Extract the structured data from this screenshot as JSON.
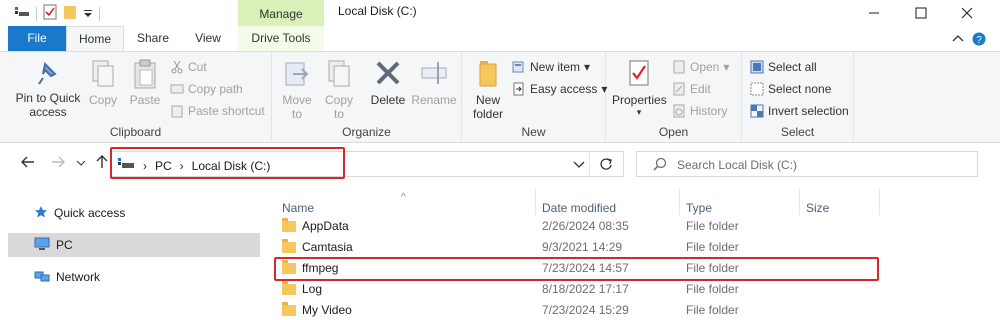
{
  "window": {
    "title": "Local Disk (C:)",
    "contextual_tab_group": "Manage"
  },
  "ribbon_tabs": {
    "file": "File",
    "home": "Home",
    "share": "Share",
    "view": "View",
    "drive_tools": "Drive Tools"
  },
  "clipboard": {
    "label": "Clipboard",
    "pin": [
      "Pin to Quick",
      "access"
    ],
    "copy": "Copy",
    "paste": "Paste",
    "cut": "Cut",
    "copy_path": "Copy path",
    "paste_shortcut": "Paste shortcut"
  },
  "organize": {
    "label": "Organize",
    "move_to": [
      "Move",
      "to"
    ],
    "copy_to": [
      "Copy",
      "to"
    ],
    "delete": "Delete",
    "rename": "Rename"
  },
  "new_group": {
    "label": "New",
    "new_folder": [
      "New",
      "folder"
    ],
    "new_item": "New item",
    "easy_access": "Easy access"
  },
  "open_group": {
    "label": "Open",
    "properties": "Properties",
    "open": "Open",
    "edit": "Edit",
    "history": "History"
  },
  "select_group": {
    "label": "Select",
    "select_all": "Select all",
    "select_none": "Select none",
    "invert_selection": "Invert selection"
  },
  "address": {
    "crumbs": [
      "PC",
      "Local Disk (C:)"
    ],
    "search_placeholder": "Search Local Disk (C:)"
  },
  "nav_pane": {
    "items": [
      "Quick access",
      "PC",
      "Network"
    ],
    "selected": "PC"
  },
  "columns": {
    "name": "Name",
    "date_modified": "Date modified",
    "type": "Type",
    "size": "Size"
  },
  "files": [
    {
      "name": "AppData",
      "date": "2/26/2024 08:35",
      "type": "File folder"
    },
    {
      "name": "Camtasia",
      "date": "9/3/2021 14:29",
      "type": "File folder"
    },
    {
      "name": "ffmpeg",
      "date": "7/23/2024 14:57",
      "type": "File folder"
    },
    {
      "name": "Log",
      "date": "8/18/2022 17:17",
      "type": "File folder"
    },
    {
      "name": "My Video",
      "date": "7/23/2024 15:29",
      "type": "File folder"
    }
  ],
  "highlighted_file": "ffmpeg",
  "colors": {
    "file_tab": "#1979ca",
    "manage_tab": "#d9f0b8",
    "highlight": "#d9262b",
    "folder": "#f5c75d"
  }
}
